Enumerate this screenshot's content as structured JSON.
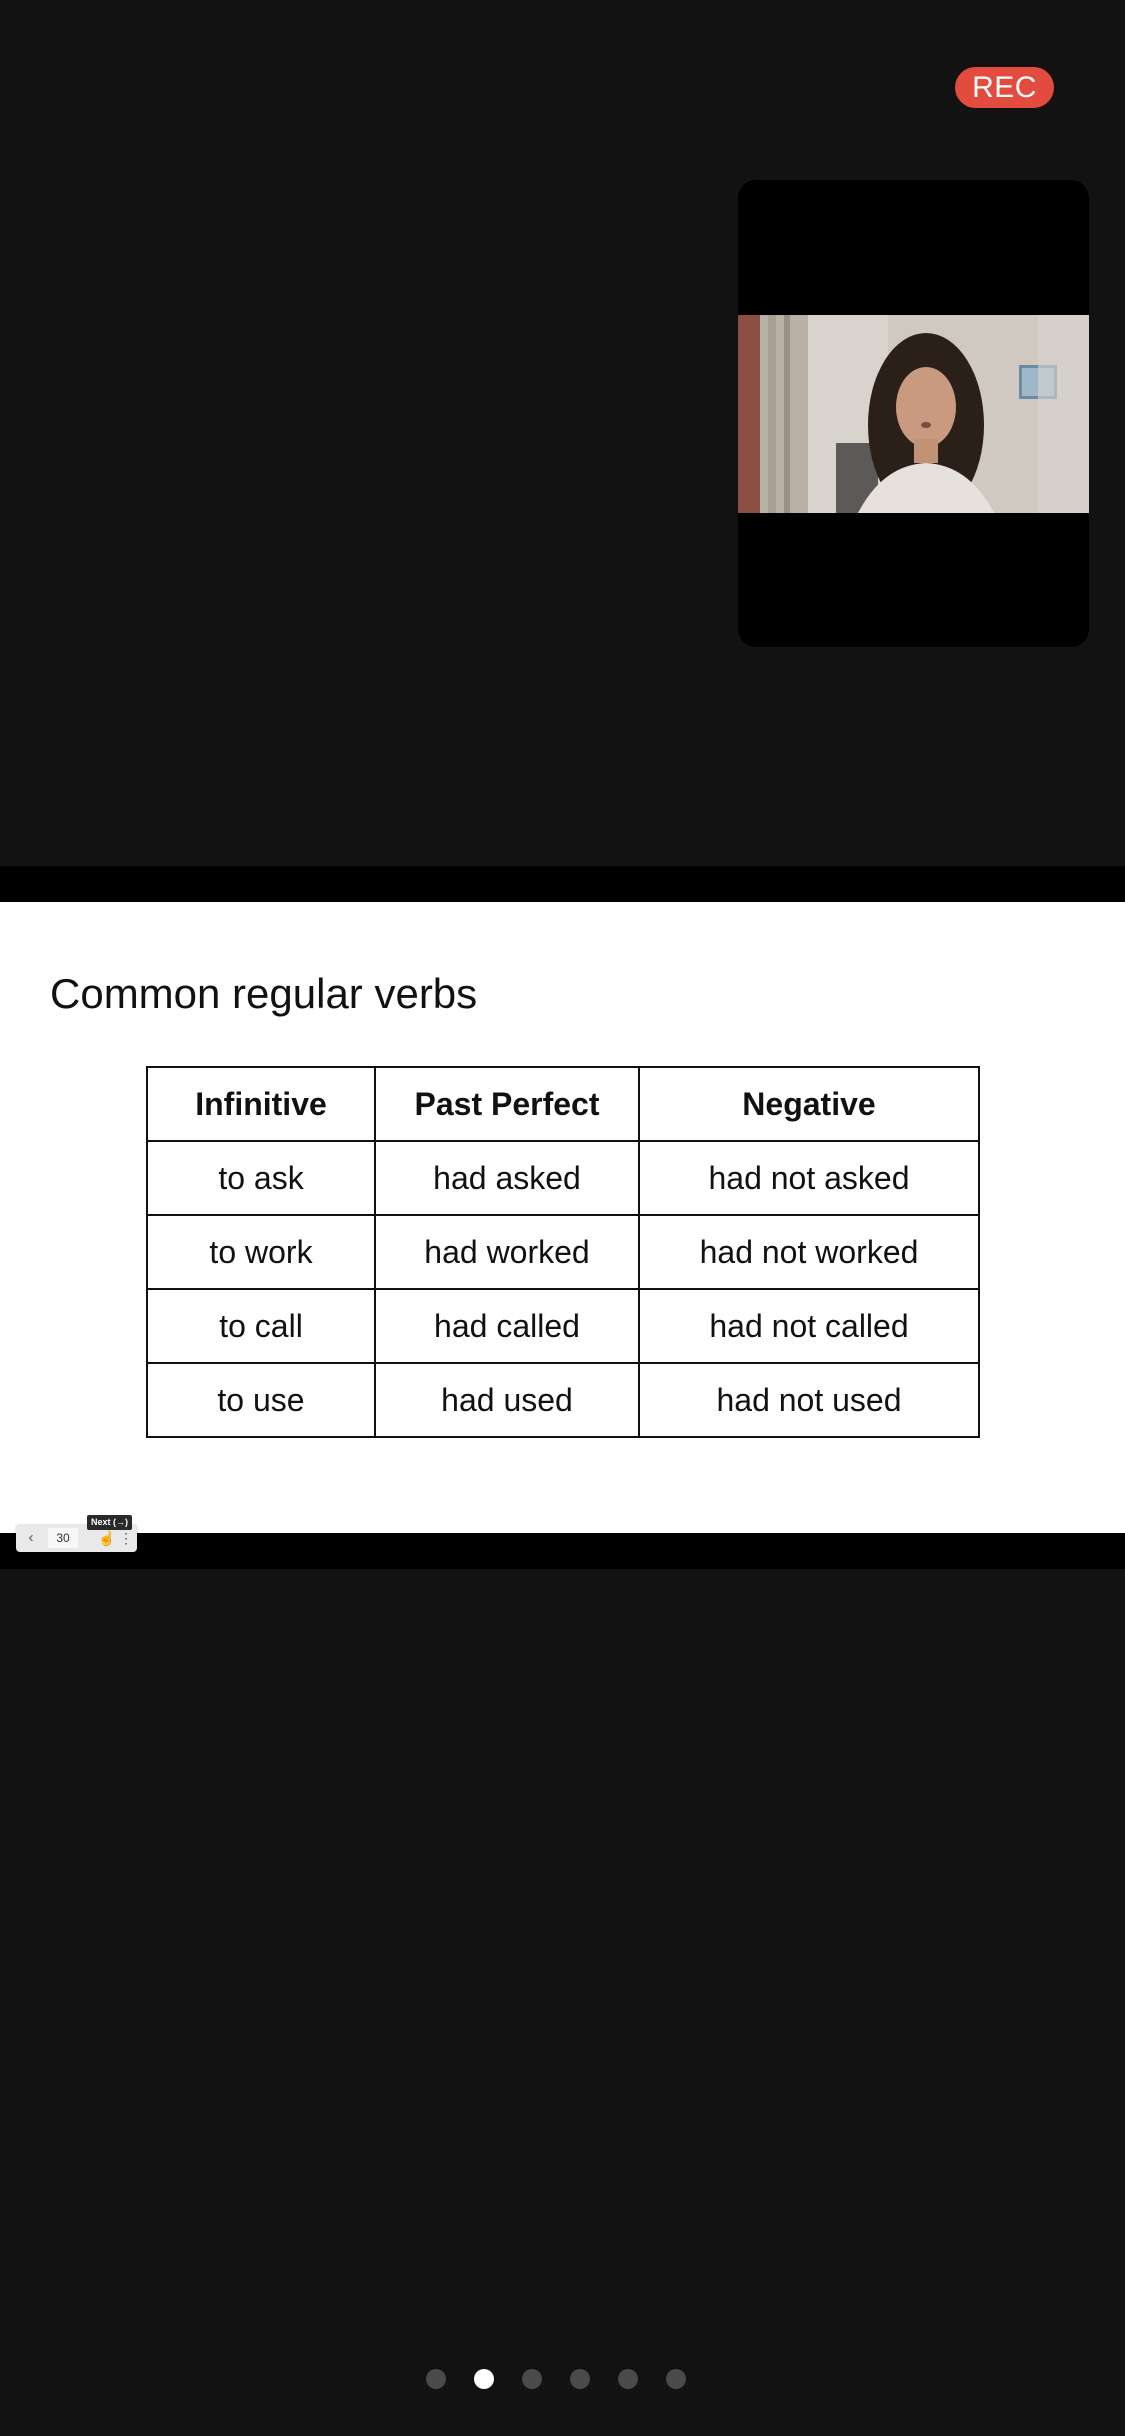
{
  "recording": {
    "label": "REC",
    "color": "#e34b3f"
  },
  "participant_video": {
    "description_icon": "participant-video"
  },
  "slide": {
    "title": "Common regular verbs",
    "table": {
      "headers": [
        "Infinitive",
        "Past Perfect",
        "Negative"
      ],
      "rows": [
        [
          "to ask",
          "had asked",
          "had not asked"
        ],
        [
          "to work",
          "had worked",
          "had not worked"
        ],
        [
          "to call",
          "had called",
          "had not called"
        ],
        [
          "to use",
          "had used",
          "had not used"
        ]
      ]
    }
  },
  "slide_controls": {
    "prev_icon": "chevron-left-icon",
    "page_number": "30",
    "next_icon": "cursor-hand-icon",
    "more_icon": "more-vertical-icon",
    "tooltip": "Next (→)"
  },
  "page_indicator": {
    "count": 6,
    "active_index": 1
  }
}
